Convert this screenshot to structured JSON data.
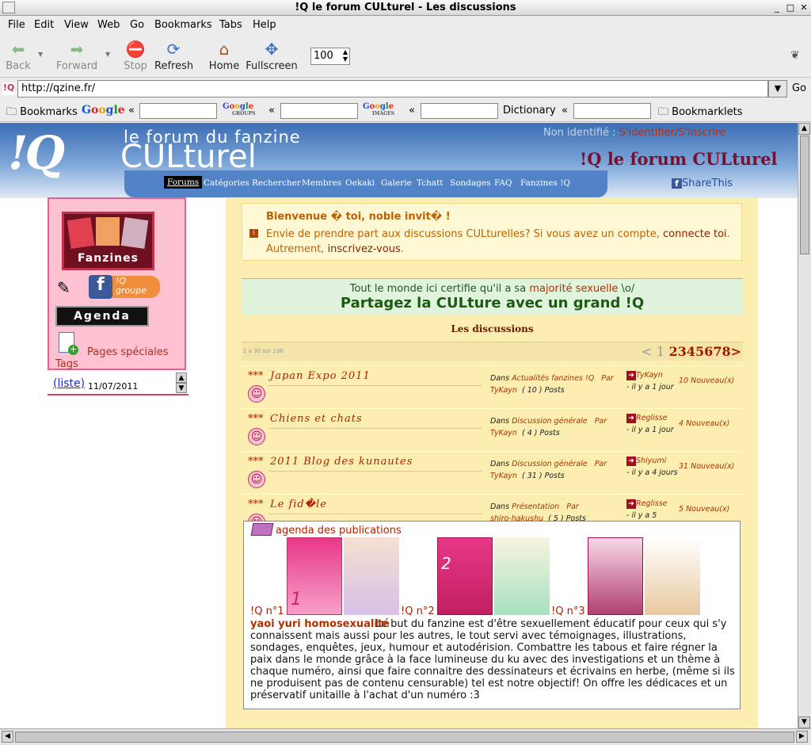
{
  "window": {
    "title": "!Q le forum CULturel - Les discussions"
  },
  "menu": [
    "File",
    "Edit",
    "View",
    "Web",
    "Go",
    "Bookmarks",
    "Tabs",
    "Help"
  ],
  "toolbar": {
    "back": "Back",
    "forward": "Forward",
    "stop": "Stop",
    "refresh": "Refresh",
    "home": "Home",
    "fullscreen": "Fullscreen",
    "zoom": "100"
  },
  "urlbar": {
    "url": "http://qzine.fr/",
    "go": "Go"
  },
  "bookmarks": {
    "bookmarks": "Bookmarks",
    "dictionary": "Dictionary",
    "bookmarklets": "Bookmarklets",
    "google": "Google",
    "groups": "GROUPS",
    "images": "IMAGES"
  },
  "header": {
    "logo": "!Q",
    "tagline": "le forum du fanzine",
    "brand": "CULturel",
    "status": "Non identifié :",
    "login": "S'identifier/S'inscrire",
    "sitename": "!Q le forum CULturel",
    "share": "ShareThis"
  },
  "nav": [
    "Forums",
    "Catégories",
    "Rechercher",
    "Membres",
    "Oekaki",
    "Galerie",
    "Tchatt",
    "Sondages",
    "FAQ",
    "Fanzines !Q"
  ],
  "sidebar": {
    "fanzines": "Fanzines",
    "fb_line1": "!Q",
    "fb_line2": "groupe",
    "agenda": "Agenda",
    "pages": "Pages spéciales",
    "tags": "Tags",
    "tag_link": "(liste)",
    "tag_date": "11/07/2011"
  },
  "welcome": {
    "title": "Bienvenue � toi, noble invit� !",
    "line1": "Envie de prendre part aux discussions CULturelles? Si vous avez un compte,",
    "link1": "connecte toi",
    "line2": "Autrement,",
    "link2": "inscrivez-vous"
  },
  "promo": {
    "line1a": "Tout le monde ici certifie qu'il a sa",
    "line1b": "majorité sexuelle",
    "line1c": "\\o/",
    "headline": "Partagez la CULture avec un grand !Q"
  },
  "discussions": {
    "title": "Les discussions",
    "count": "1 à 30 sur 236",
    "pages": [
      "<",
      "1",
      "2",
      "3",
      "4",
      "5",
      "6",
      "7",
      "8",
      ">"
    ],
    "topics": [
      {
        "stars": "***",
        "title": "Japan Expo 2011",
        "dans": "Dans",
        "category": "Actualités fanzines !Q",
        "par": "Par",
        "author": "TyKayn",
        "posts": "( 10 ) Posts",
        "last_user": "TyKayn",
        "last_time": "- il y a 1 jour",
        "new": "10 Nouveau(x)"
      },
      {
        "stars": "***",
        "title": "Chiens et chats",
        "dans": "Dans",
        "category": "Discussion générale",
        "par": "Par",
        "author": "TyKayn",
        "posts": "( 4 ) Posts",
        "last_user": "Reglisse",
        "last_time": "- il y a 1 jour",
        "new": "4 Nouveau(x)"
      },
      {
        "stars": "***",
        "title": "2011 Blog des kunautes",
        "dans": "Dans",
        "category": "Discussion générale",
        "par": "Par",
        "author": "TyKayn",
        "posts": "( 31 ) Posts",
        "last_user": "Shiyumi",
        "last_time": "- il y a 4 jours",
        "new": "31 Nouveau(x)"
      },
      {
        "stars": "***",
        "title": "Le fid�le",
        "dans": "Dans",
        "category": "Présentation",
        "par": "Par",
        "author": "shiro-hakushu",
        "posts": "( 5 ) Posts",
        "last_user": "Reglisse",
        "last_time": "- il y a 5",
        "new": "5 Nouveau(x)"
      }
    ]
  },
  "agenda": {
    "title": "agenda des publications",
    "issues": [
      "!Q n°1",
      "!Q n°2",
      "!Q n°3"
    ],
    "keywords": "yaoi yuri homosexualité",
    "description": "Le but du fanzine est d'être sexuellement éducatif pour ceux qui s'y connaissent mais aussi pour les autres, le tout servi avec témoignages, illustrations, sondages, enquêtes, jeux, humour et autodérision. Combattre les tabous et faire régner la paix dans le monde grâce à la face lumineuse du ku avec des investigations et un thème à chaque numéro, ainsi que faire connaitre des dessinateurs et écrivains en herbe, (même si ils ne produisent pas de contenu censurable) tel est notre objectif! On offre les dédicaces et un préservatif unitaille à l'achat d'un numéro :3"
  }
}
